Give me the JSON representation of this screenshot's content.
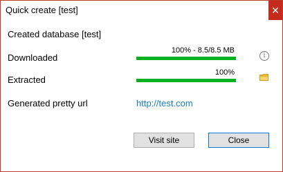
{
  "window": {
    "title": "Quick create [test]",
    "close_glyph": "✕"
  },
  "content": {
    "created_label": "Created database [test]",
    "downloaded_label": "Downloaded",
    "downloaded_progress_text": "100%  -  8.5/8.5 MB",
    "downloaded_progress_fraction": 1.0,
    "extracted_label": "Extracted",
    "extracted_progress_text": "100%",
    "extracted_progress_fraction": 1.0,
    "pretty_url_label": "Generated pretty url",
    "pretty_url": "http://test.com",
    "info_icon": "info-icon",
    "folder_icon": "folder-icon"
  },
  "buttons": {
    "visit_site": "Visit site",
    "close": "Close"
  },
  "colors": {
    "progress": "#06b025",
    "link": "#1a7dc9",
    "close_button": "#c42b1c"
  }
}
